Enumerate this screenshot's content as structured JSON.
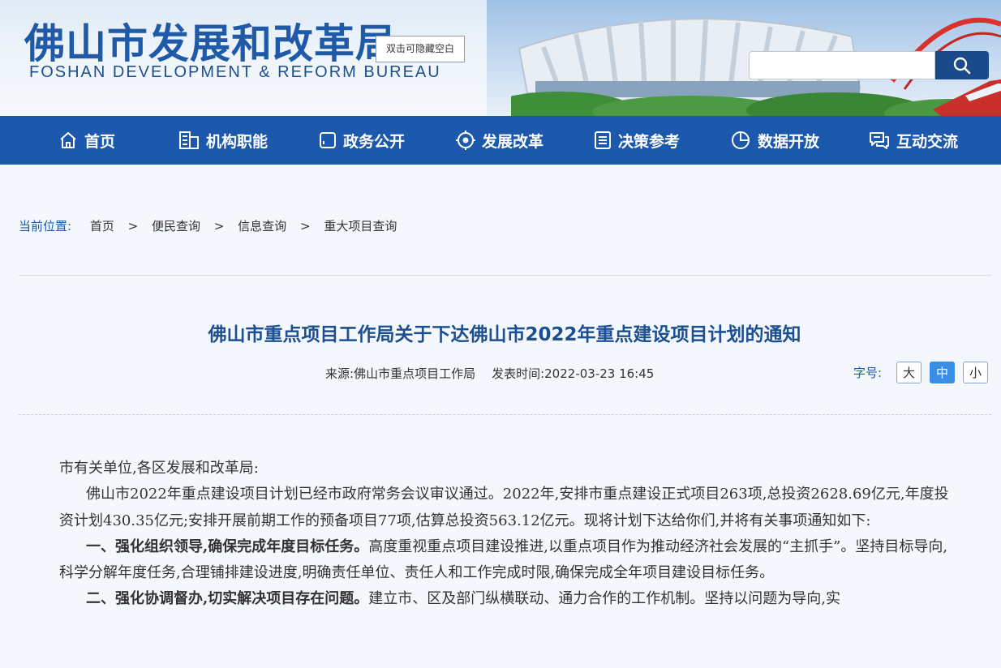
{
  "header": {
    "logo_cn": "佛山市发展和改革局",
    "logo_en": "FOSHAN DEVELOPMENT & REFORM BUREAU",
    "hide_tip": "双击可隐藏空白",
    "search_placeholder": ""
  },
  "nav": {
    "items": [
      {
        "label": "首页",
        "icon": "home-icon"
      },
      {
        "label": "机构职能",
        "icon": "building-icon"
      },
      {
        "label": "政务公开",
        "icon": "square-icon"
      },
      {
        "label": "发展改革",
        "icon": "target-icon"
      },
      {
        "label": "决策参考",
        "icon": "document-icon"
      },
      {
        "label": "数据开放",
        "icon": "pie-chart-icon"
      },
      {
        "label": "互动交流",
        "icon": "chat-icon"
      }
    ]
  },
  "breadcrumb": {
    "label": "当前位置:",
    "items": [
      "首页",
      "便民查询",
      "信息查询",
      "重大项目查询"
    ],
    "separator": ">"
  },
  "article": {
    "title": "佛山市重点项目工作局关于下达佛山市2022年重点建设项目计划的通知",
    "source_label": "来源:",
    "source": "佛山市重点项目工作局",
    "time_label": "发表时间:",
    "time": "2022-03-23 16:45",
    "fontsize_label": "字号:",
    "fontsize_options": [
      "大",
      "中",
      "小"
    ],
    "fontsize_selected": "中",
    "salutation": "市有关单位,各区发展和改革局:",
    "para1": "佛山市2022年重点建设项目计划已经市政府常务会议审议通过。2022年,安排市重点建设正式项目263项,总投资2628.69亿元,年度投资计划430.35亿元;安排开展前期工作的预备项目77项,估算总投资563.12亿元。现将计划下达给你们,并将有关事项通知如下:",
    "para2_bold": "一、强化组织领导,确保完成年度目标任务。",
    "para2_text": "高度重视重点项目建设推进,以重点项目作为推动经济社会发展的“主抓手”。坚持目标导向,科学分解年度任务,合理铺排建设进度,明确责任单位、责任人和工作完成时限,确保完成全年项目建设目标任务。",
    "para3_bold": "二、强化协调督办,切实解决项目存在问题。",
    "para3_text": "建立市、区及部门纵横联动、通力合作的工作机制。坚持以问题为导向,实"
  }
}
